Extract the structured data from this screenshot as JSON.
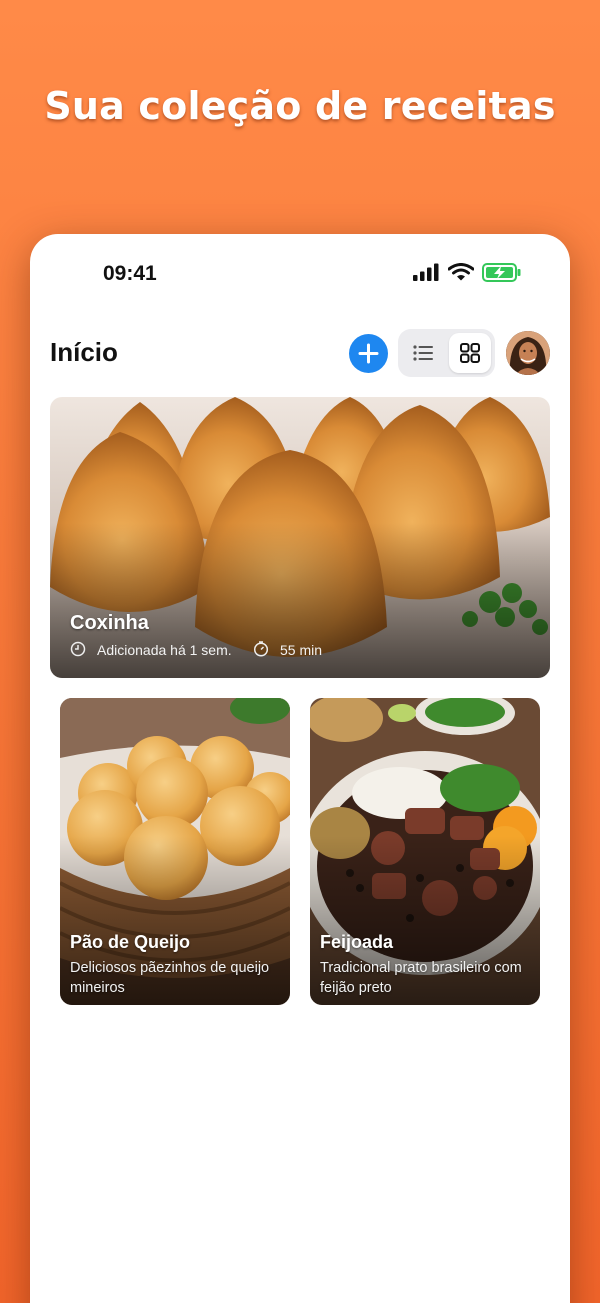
{
  "headline": "Sua coleção de receitas",
  "status_bar": {
    "time": "09:41",
    "battery_color": "#34c759"
  },
  "header": {
    "title": "Início"
  },
  "accent_color": "#1e87f0",
  "recipes": [
    {
      "title": "Coxinha",
      "added": "Adicionada há 1 sem.",
      "duration": "55 min"
    },
    {
      "title": "Pão de Queijo",
      "description": "Deliciosos pãezinhos de queijo mineiros"
    },
    {
      "title": "Feijoada",
      "description": "Tradicional prato brasileiro com feijão preto"
    }
  ],
  "icons": [
    "signal-icon",
    "wifi-icon",
    "battery-charging-icon",
    "plus-icon",
    "list-view-icon",
    "grid-view-icon",
    "avatar",
    "clock-icon",
    "timer-icon"
  ]
}
